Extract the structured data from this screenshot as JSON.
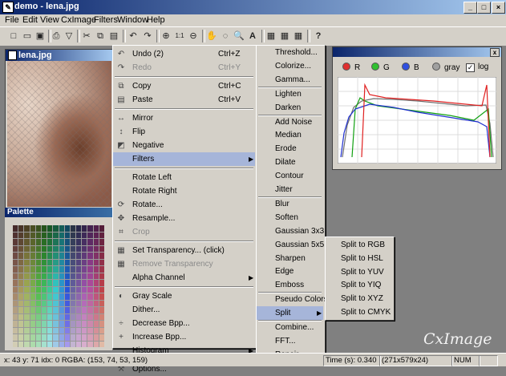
{
  "window": {
    "title": "demo - lena.jpg",
    "controls": [
      "_",
      "□",
      "×"
    ]
  },
  "menubar": [
    "File",
    "Edit",
    "View",
    "CxImage",
    "Filters",
    "Window",
    "Help"
  ],
  "toolbar": [
    "□",
    "▭",
    "▣",
    "⎙",
    "▽",
    "✂",
    "⧉",
    "▤",
    "↶",
    "↷",
    "⊕",
    "1:1",
    "⊖",
    "✋",
    "◌",
    "🔍",
    "A",
    "▦",
    "▦",
    "▦",
    "?"
  ],
  "lena_window": {
    "title": "lena.jpg"
  },
  "palette_window": {
    "title": "Palette"
  },
  "edit_menu": [
    {
      "icon": "↶",
      "label": "Undo (2)",
      "shortcut": "Ctrl+Z",
      "disabled": false
    },
    {
      "icon": "↷",
      "label": "Redo",
      "shortcut": "Ctrl+Y",
      "disabled": true
    },
    {
      "sep": true
    },
    {
      "icon": "⧉",
      "label": "Copy",
      "shortcut": "Ctrl+C",
      "disabled": false
    },
    {
      "icon": "▤",
      "label": "Paste",
      "shortcut": "Ctrl+V",
      "disabled": false
    },
    {
      "sep": true
    },
    {
      "icon": "↔",
      "label": "Mirror",
      "disabled": false
    },
    {
      "icon": "↕",
      "label": "Flip",
      "disabled": false
    },
    {
      "icon": "◩",
      "label": "Negative",
      "disabled": false
    },
    {
      "label": "Filters",
      "disabled": false,
      "submenu": true,
      "selected": true
    },
    {
      "sep": true
    },
    {
      "label": "Rotate Left",
      "disabled": false
    },
    {
      "label": "Rotate Right",
      "disabled": false
    },
    {
      "icon": "⟳",
      "label": "Rotate...",
      "disabled": false
    },
    {
      "icon": "✥",
      "label": "Resample...",
      "disabled": false
    },
    {
      "icon": "⌗",
      "label": "Crop",
      "disabled": true
    },
    {
      "sep": true
    },
    {
      "icon": "▦",
      "label": "Set Transparency... (click)",
      "disabled": false
    },
    {
      "icon": "▦",
      "label": "Remove Transparency",
      "disabled": true
    },
    {
      "label": "Alpha Channel",
      "disabled": false,
      "submenu": true
    },
    {
      "sep": true
    },
    {
      "icon": "◐",
      "label": "Gray Scale",
      "disabled": false
    },
    {
      "label": "Dither...",
      "disabled": false
    },
    {
      "icon": "÷",
      "label": "Decrease Bpp...",
      "disabled": false
    },
    {
      "icon": "+",
      "label": "Increase Bpp...",
      "disabled": false
    },
    {
      "label": "Histogram",
      "disabled": false,
      "submenu": true
    },
    {
      "sep": true
    },
    {
      "icon": "⚒",
      "label": "Options...",
      "disabled": false
    }
  ],
  "filters_menu": [
    {
      "label": "Threshold..."
    },
    {
      "label": "Colorize..."
    },
    {
      "label": "Gamma..."
    },
    {
      "sep": true
    },
    {
      "label": "Lighten"
    },
    {
      "label": "Darken"
    },
    {
      "sep": true
    },
    {
      "label": "Add Noise"
    },
    {
      "label": "Median"
    },
    {
      "label": "Erode"
    },
    {
      "label": "Dilate"
    },
    {
      "label": "Contour"
    },
    {
      "label": "Jitter"
    },
    {
      "sep": true
    },
    {
      "label": "Blur"
    },
    {
      "label": "Soften"
    },
    {
      "label": "Gaussian 3x3"
    },
    {
      "label": "Gaussian 5x5"
    },
    {
      "label": "Sharpen"
    },
    {
      "label": "Edge"
    },
    {
      "label": "Emboss"
    },
    {
      "sep": true
    },
    {
      "label": "Pseudo Colors"
    },
    {
      "label": "Split",
      "submenu": true,
      "selected": true
    },
    {
      "sep": true
    },
    {
      "label": "Combine..."
    },
    {
      "label": "FFT..."
    },
    {
      "label": "Repair..."
    }
  ],
  "split_menu": [
    "Split to RGB",
    "Split to HSL",
    "Split to YUV",
    "Split to YIQ",
    "Split to XYZ",
    "Split to CMYK"
  ],
  "histogram": {
    "channels": [
      {
        "label": "R",
        "color": "#e03030"
      },
      {
        "label": "G",
        "color": "#30c030"
      },
      {
        "label": "B",
        "color": "#3050e0"
      },
      {
        "label": "gray",
        "color": "#a0a0a0"
      }
    ],
    "log_label": "log",
    "log_checked": true,
    "colors": {
      "red": "#e02020",
      "green": "#10a010",
      "blue": "#2030d0",
      "gray": "#707070"
    }
  },
  "watermark": "CxImage",
  "status": {
    "coords": "x: 43 y: 71  idx: 0  RGBA: (153, 74, 53, 159)",
    "time": "Time (s): 0.340",
    "size": "(271x579x24)",
    "num": "NUM"
  }
}
